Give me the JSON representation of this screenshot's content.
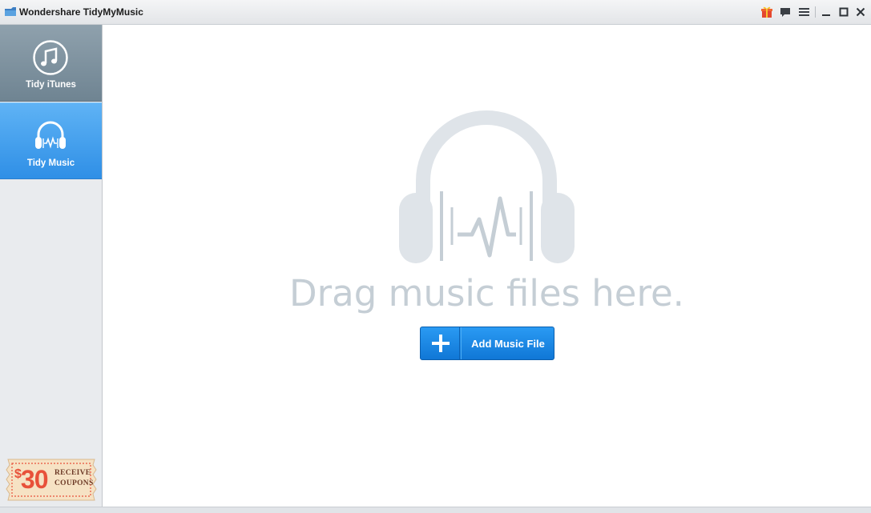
{
  "window": {
    "title": "Wondershare TidyMyMusic"
  },
  "titlebar": {
    "icons": [
      "gift-icon",
      "feedback-icon",
      "menu-icon",
      "minimize-icon",
      "maximize-icon",
      "close-icon"
    ]
  },
  "sidebar": {
    "items": [
      {
        "label": "Tidy iTunes",
        "icon": "music-note-icon",
        "selected": false
      },
      {
        "label": "Tidy Music",
        "icon": "headphones-icon",
        "selected": true
      }
    ],
    "coupon": {
      "dollar": "$",
      "amount": "30",
      "line1": "RECEIVE",
      "line2": "COUPONS"
    }
  },
  "main": {
    "drop_text": "Drag music files here.",
    "add_button_label": "Add Music File"
  },
  "colors": {
    "accent": "#2f8fe6",
    "sidebar_inactive": "#7b8e9b",
    "placeholder_gray": "#c5ced5",
    "coupon_red": "#e8513a"
  }
}
